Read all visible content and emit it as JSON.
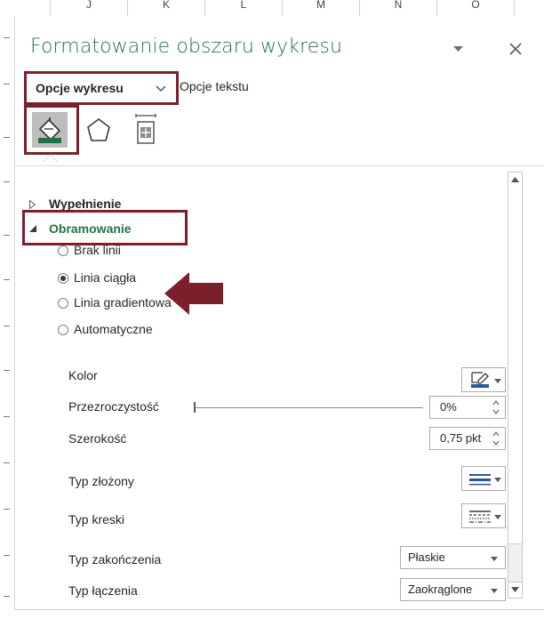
{
  "spreadsheet": {
    "column_headers": [
      "J",
      "K",
      "L",
      "M",
      "N",
      "O"
    ]
  },
  "pane": {
    "title": "Formatowanie obszaru wykresu",
    "tabs": [
      {
        "label": "Opcje wykresu",
        "active": true
      },
      {
        "label": "Opcje tekstu",
        "active": false
      }
    ],
    "icon_tabs": [
      {
        "icon": "fill-line-icon",
        "active": true
      },
      {
        "icon": "effects-pentagon-icon",
        "active": false
      },
      {
        "icon": "size-properties-icon",
        "active": false
      }
    ]
  },
  "sections": {
    "fill": {
      "label": "Wypełnienie",
      "expanded": false
    },
    "border": {
      "label": "Obramowanie",
      "expanded": true
    }
  },
  "line_type_options": [
    {
      "label": "Brak linii",
      "selected": false
    },
    {
      "label": "Linia ciągła",
      "selected": true
    },
    {
      "label": "Linia gradientowa",
      "selected": false
    },
    {
      "label": "Automatyczne",
      "selected": false
    }
  ],
  "properties": {
    "color": {
      "label": "Kolor"
    },
    "transparency": {
      "label": "Przezroczystość",
      "value": "0%",
      "level": 0
    },
    "width": {
      "label": "Szerokość",
      "value": "0,75 pkt"
    },
    "compound_type": {
      "label": "Typ złożony"
    },
    "dash_type": {
      "label": "Typ kreski"
    },
    "cap_type": {
      "label": "Typ zakończenia",
      "value": "Płaskie"
    },
    "join_type": {
      "label": "Typ łączenia",
      "value": "Zaokrąglone"
    }
  },
  "colors": {
    "accent_green": "#217346",
    "highlight_maroon": "#7b1f2b",
    "tab_blue": "#2b579a"
  }
}
